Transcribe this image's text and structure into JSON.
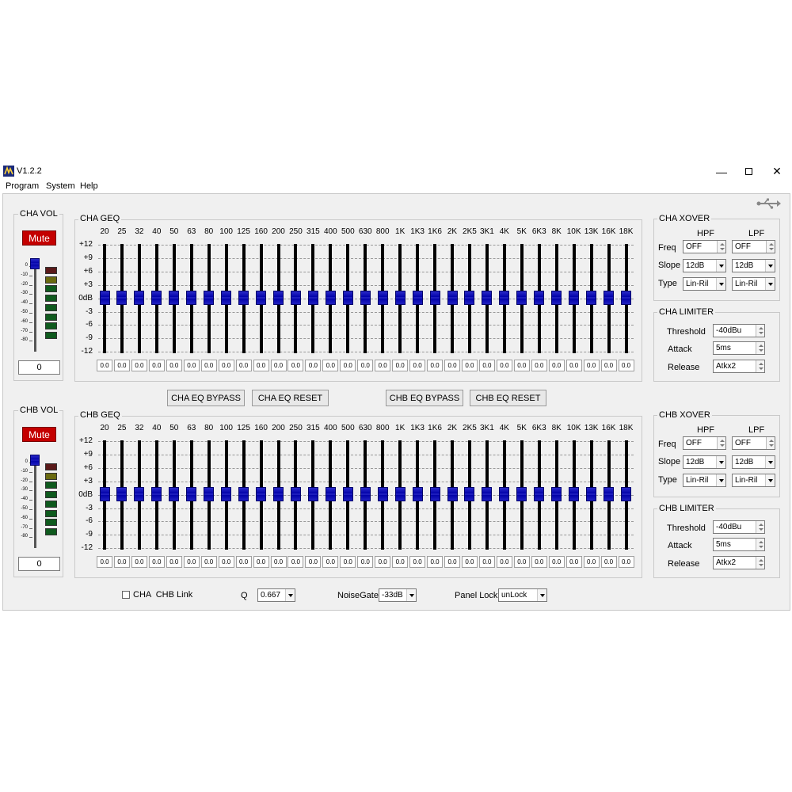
{
  "app": {
    "title": "V1.2.2"
  },
  "menu": [
    "Program",
    "System",
    "Help"
  ],
  "colors": {
    "accent": "#0000a8",
    "mute": "#c40000",
    "background": "#f0f0f0"
  },
  "usb_icon": "usb-icon",
  "freq_labels": [
    "20",
    "25",
    "32",
    "40",
    "50",
    "63",
    "80",
    "100",
    "125",
    "160",
    "200",
    "250",
    "315",
    "400",
    "500",
    "630",
    "800",
    "1K",
    "1K3",
    "1K6",
    "2K",
    "2K5",
    "3K1",
    "4K",
    "5K",
    "6K3",
    "8K",
    "10K",
    "13K",
    "16K",
    "18K"
  ],
  "db_labels": [
    "+12",
    "+9",
    "+6",
    "+3",
    "0dB",
    "-3",
    "-6",
    "-9",
    "-12"
  ],
  "vol_labels": [
    "0",
    "-10",
    "-20",
    "-30",
    "-40",
    "-50",
    "-60",
    "-70",
    "-80"
  ],
  "channels": [
    {
      "vol_title": "CHA VOL",
      "mute_label": "Mute",
      "vol_value": "0",
      "vol_level": 0,
      "meter_colors": [
        "#5a1a1a",
        "#6a6a10",
        "#0f5a1e",
        "#0f5a1e",
        "#0f5a1e",
        "#0f5a1e",
        "#0f5a1e",
        "#0f5a1e"
      ],
      "geq_title": "CHA GEQ",
      "gains": [
        "0.0",
        "0.0",
        "0.0",
        "0.0",
        "0.0",
        "0.0",
        "0.0",
        "0.0",
        "0.0",
        "0.0",
        "0.0",
        "0.0",
        "0.0",
        "0.0",
        "0.0",
        "0.0",
        "0.0",
        "0.0",
        "0.0",
        "0.0",
        "0.0",
        "0.0",
        "0.0",
        "0.0",
        "0.0",
        "0.0",
        "0.0",
        "0.0",
        "0.0",
        "0.0",
        "0.0"
      ],
      "xover": {
        "title": "CHA XOVER",
        "hpf": "HPF",
        "lpf": "LPF",
        "freq_label": "Freq",
        "slope_label": "Slope",
        "type_label": "Type",
        "hpf_freq": "OFF",
        "lpf_freq": "OFF",
        "hpf_slope": "12dB",
        "lpf_slope": "12dB",
        "hpf_type": "Lin-Ril",
        "lpf_type": "Lin-Ril"
      },
      "limiter": {
        "title": "CHA LIMITER",
        "threshold_label": "Threshold",
        "attack_label": "Attack",
        "release_label": "Release",
        "threshold": "-40dBu",
        "attack": "5ms",
        "release": "Atkx2"
      }
    },
    {
      "vol_title": "CHB VOL",
      "mute_label": "Mute",
      "vol_value": "0",
      "vol_level": 0,
      "meter_colors": [
        "#5a1a1a",
        "#6a6a10",
        "#0f5a1e",
        "#0f5a1e",
        "#0f5a1e",
        "#0f5a1e",
        "#0f5a1e",
        "#0f5a1e"
      ],
      "geq_title": "CHB GEQ",
      "gains": [
        "0.0",
        "0.0",
        "0.0",
        "0.0",
        "0.0",
        "0.0",
        "0.0",
        "0.0",
        "0.0",
        "0.0",
        "0.0",
        "0.0",
        "0.0",
        "0.0",
        "0.0",
        "0.0",
        "0.0",
        "0.0",
        "0.0",
        "0.0",
        "0.0",
        "0.0",
        "0.0",
        "0.0",
        "0.0",
        "0.0",
        "0.0",
        "0.0",
        "0.0",
        "0.0",
        "0.0"
      ],
      "xover": {
        "title": "CHB XOVER",
        "hpf": "HPF",
        "lpf": "LPF",
        "freq_label": "Freq",
        "slope_label": "Slope",
        "type_label": "Type",
        "hpf_freq": "OFF",
        "lpf_freq": "OFF",
        "hpf_slope": "12dB",
        "lpf_slope": "12dB",
        "hpf_type": "Lin-Ril",
        "lpf_type": "Lin-Ril"
      },
      "limiter": {
        "title": "CHB LIMITER",
        "threshold_label": "Threshold",
        "attack_label": "Attack",
        "release_label": "Release",
        "threshold": "-40dBu",
        "attack": "5ms",
        "release": "Atkx2"
      }
    }
  ],
  "buttons": {
    "cha_bypass": "CHA EQ BYPASS",
    "cha_reset": "CHA EQ RESET",
    "chb_bypass": "CHB EQ BYPASS",
    "chb_reset": "CHB EQ RESET"
  },
  "footer": {
    "link_label": "CHA  CHB Link",
    "link_checked": false,
    "q_label": "Q",
    "q_value": "0.667",
    "noisegate_label": "NoiseGate",
    "noisegate_value": "-33dB",
    "panellock_label": "Panel Lock",
    "panellock_value": "unLock"
  }
}
